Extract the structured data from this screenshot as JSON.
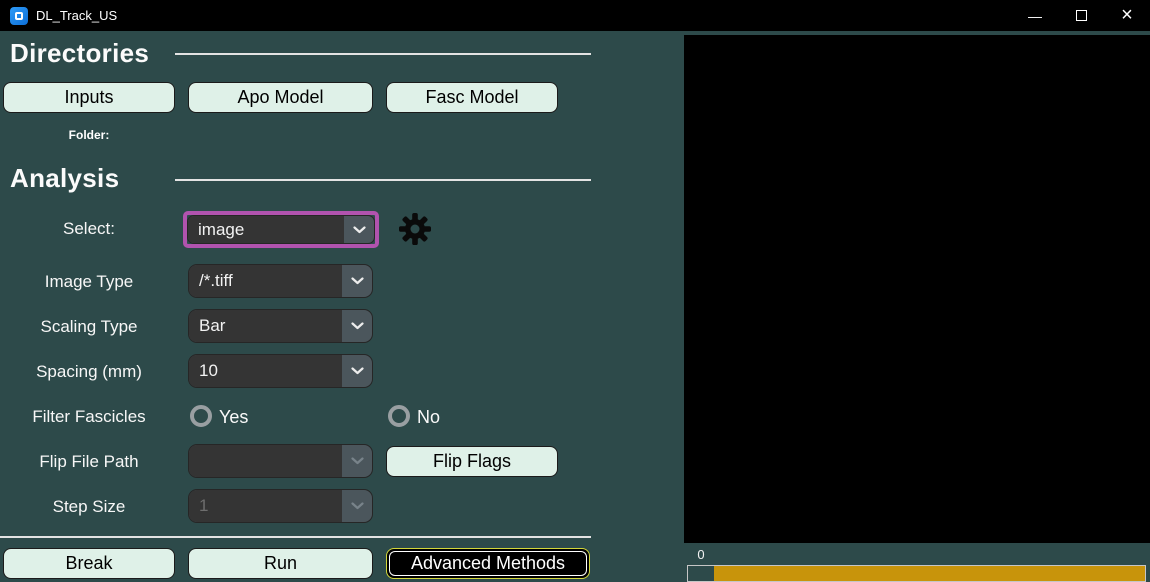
{
  "titlebar": {
    "title": "DL_Track_US",
    "minimize_icon": "—",
    "close_icon": "×"
  },
  "directories": {
    "heading": "Directories",
    "inputs_button": "Inputs",
    "apo_model_button": "Apo Model",
    "fasc_model_button": "Fasc Model",
    "folder_label": "Folder:"
  },
  "analysis": {
    "heading": "Analysis",
    "select": {
      "label": "Select:",
      "value": "image"
    },
    "image_type": {
      "label": "Image Type",
      "value": "/*.tiff"
    },
    "scaling_type": {
      "label": "Scaling Type",
      "value": "Bar"
    },
    "spacing_mm": {
      "label": "Spacing (mm)",
      "value": "10"
    },
    "filter_fascicles": {
      "label": "Filter Fascicles",
      "yes_label": "Yes",
      "no_label": "No"
    },
    "flip_file_path": {
      "label": "Flip File Path",
      "value": "",
      "flip_flags_button": "Flip Flags"
    },
    "step_size": {
      "label": "Step Size",
      "value": "1"
    }
  },
  "actions": {
    "break_button": "Break",
    "run_button": "Run",
    "advanced_methods_button": "Advanced Methods"
  },
  "display_panel": {
    "progress_label": "0"
  },
  "colors": {
    "background": "#2d4a4a",
    "titlebar": "#000000",
    "button_bg": "#dff1e8",
    "select_highlight": "#b153ae",
    "progress_fill": "#c8940b",
    "advanced_border": "#d4d83a",
    "combo_field": "#343434",
    "combo_arrow_zone": "#4b565c"
  }
}
